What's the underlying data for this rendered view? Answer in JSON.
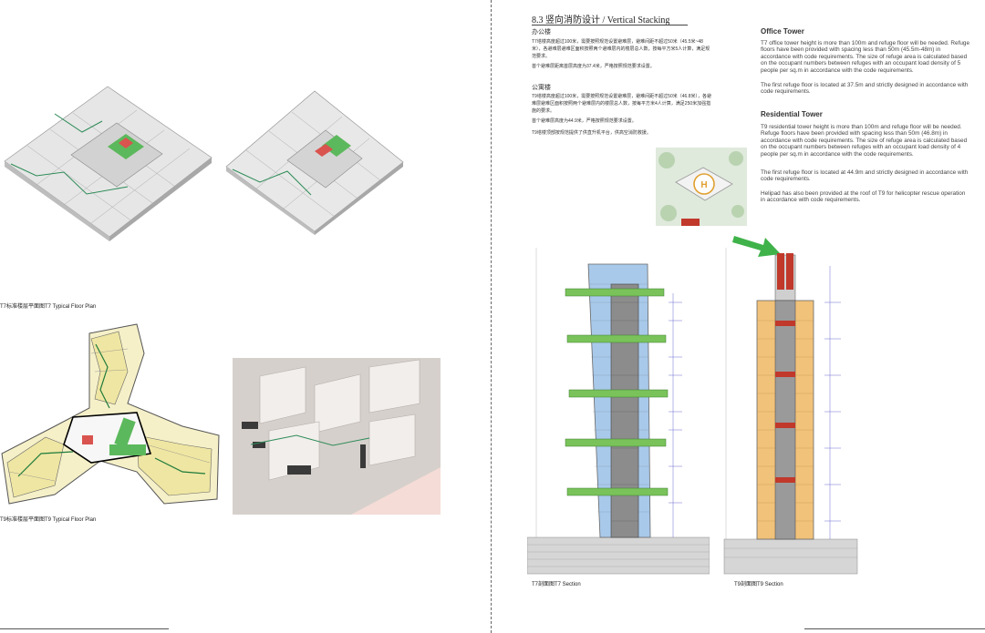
{
  "left_page": {
    "t7_plan_caption": "T7标准楼层平面图T7 Typical Floor Plan",
    "t9_plan_caption": "T9标准楼层平面图T9 Typical Floor Plan"
  },
  "right_page": {
    "section_title": "8.3  竖向消防设计 / Vertical Stacking",
    "office_zh": {
      "heading": "办公楼",
      "p1": "T7塔楼高度超过100米，需要按照规范设置避难层，避难间距不超过50米（45.5米~48米），各避难层避难区面积按照两个避难层内的楼层总人数，按每平方米5人计算，满足规范要求。",
      "p2": "首个避难层距离首层高度为37.4米，严格按照规范要求设置。"
    },
    "residential_zh": {
      "heading": "公寓楼",
      "p1": "T9塔楼高度超过100米，需要按照规范设置避难层，避难间距不超过50米（46.8米），各避难层避难区面积按照两个避难层内的楼层总人数，按每平方米4人计算，满足250米加强措施的要求。",
      "p2": "首个避难层高度为44.9米，严格按照规范要求设置。",
      "p3": "T9塔楼顶部按规范提供了供直升机平台，供高空消防救援。"
    },
    "office_en": {
      "heading": "Office Tower",
      "p1": "T7 office tower height is more than 100m and refuge floor will be needed. Refuge floors have been provided with spacing less than 50m (45.5m-48m) in accordance with code requirements. The size of refuge area is calculated based on the occupant numbers between refuges with an occupant load density of 5 people per sq.m in accordance with the code requirements.",
      "p2": "The first refuge floor is located at 37.5m and strictly designed in accordance with code requirements."
    },
    "residential_en": {
      "heading": "Residential Tower",
      "p1": "T9 residential tower height is more than 100m and refuge floor will be needed. Refuge floors have been provided with spacing less than 50m (46.8m) in accordance with code requirements. The size of refuge area is calculated based on the occupant numbers between refuges with an occupant load density of 4 people per sq.m in accordance with the code requirements.",
      "p2": "The first refuge floor is located at 44.9m and strictly designed in accordance with code requirements.",
      "p3": "Helipad has also been provided at the roof of T9 for helicopter rescue operation in accordance with code requirements."
    },
    "helipad_letter": "H",
    "t7_section_caption": "T7剖面图T7 Section",
    "t9_section_caption": "T9剖面图T9 Section"
  },
  "colors": {
    "refuge_green": "#79c35a",
    "arrow_green": "#3fb24a",
    "glass_blue": "#a9c9ea",
    "residential_orange": "#f1c27a",
    "core_red": "#c0392b"
  }
}
